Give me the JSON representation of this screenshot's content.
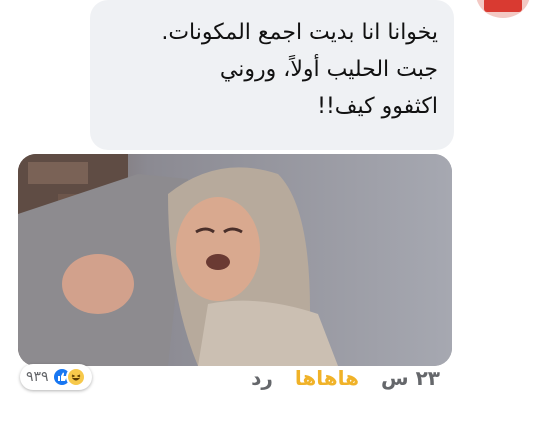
{
  "comment": {
    "lines": [
      "يخوانا انا بديت اجمع المكونات.",
      "جبت الحليب أولاً، وروني",
      "اكثفوو كيف!!"
    ]
  },
  "media": {
    "icon": "photo"
  },
  "reactions": {
    "icons": [
      "like-icon",
      "haha-icon"
    ],
    "count": "٩٣٩"
  },
  "actions": {
    "time": "٢٣ س",
    "haha": "هاهاها",
    "reply": "رد"
  },
  "colors": {
    "bubble": "#eff1f4",
    "like": "#1877f2",
    "haha": "#f0b228",
    "meta_text": "#65676b"
  }
}
